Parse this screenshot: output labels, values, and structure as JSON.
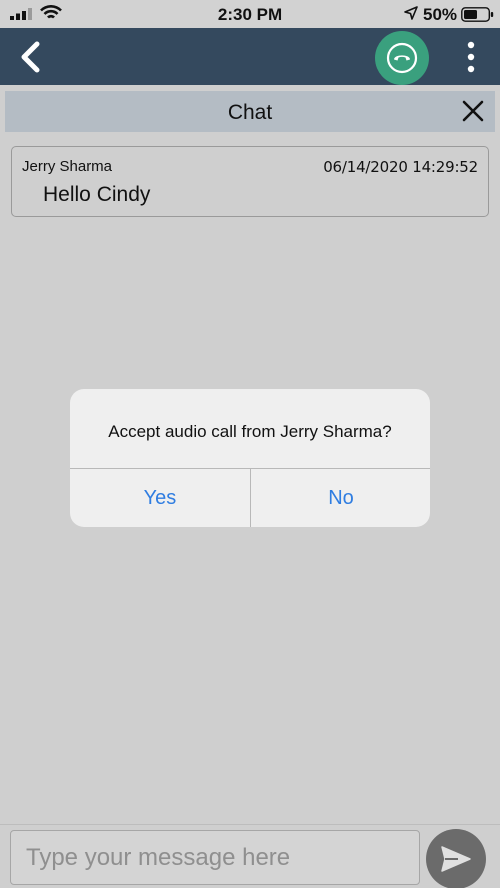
{
  "status_bar": {
    "time": "2:30 PM",
    "battery_percent": "50%",
    "icons": [
      "signal-icon",
      "wifi-icon",
      "location-arrow-icon",
      "battery-icon"
    ]
  },
  "header": {
    "icons": [
      "back-chevron-icon",
      "end-call-icon",
      "more-vertical-icon"
    ],
    "colors": {
      "background": "#34495e",
      "call_button": "#3aa07e"
    }
  },
  "chat_bar": {
    "title": "Chat",
    "close_icon": "close-icon"
  },
  "messages": [
    {
      "sender": "Jerry Sharma",
      "timestamp": "06/14/2020 14:29:52",
      "text": "Hello Cindy"
    }
  ],
  "dialog": {
    "message": "Accept audio call from Jerry Sharma?",
    "yes_label": "Yes",
    "no_label": "No",
    "button_color": "#2f7de1"
  },
  "composer": {
    "placeholder": "Type your message here",
    "value": "",
    "send_icon": "send-icon"
  }
}
